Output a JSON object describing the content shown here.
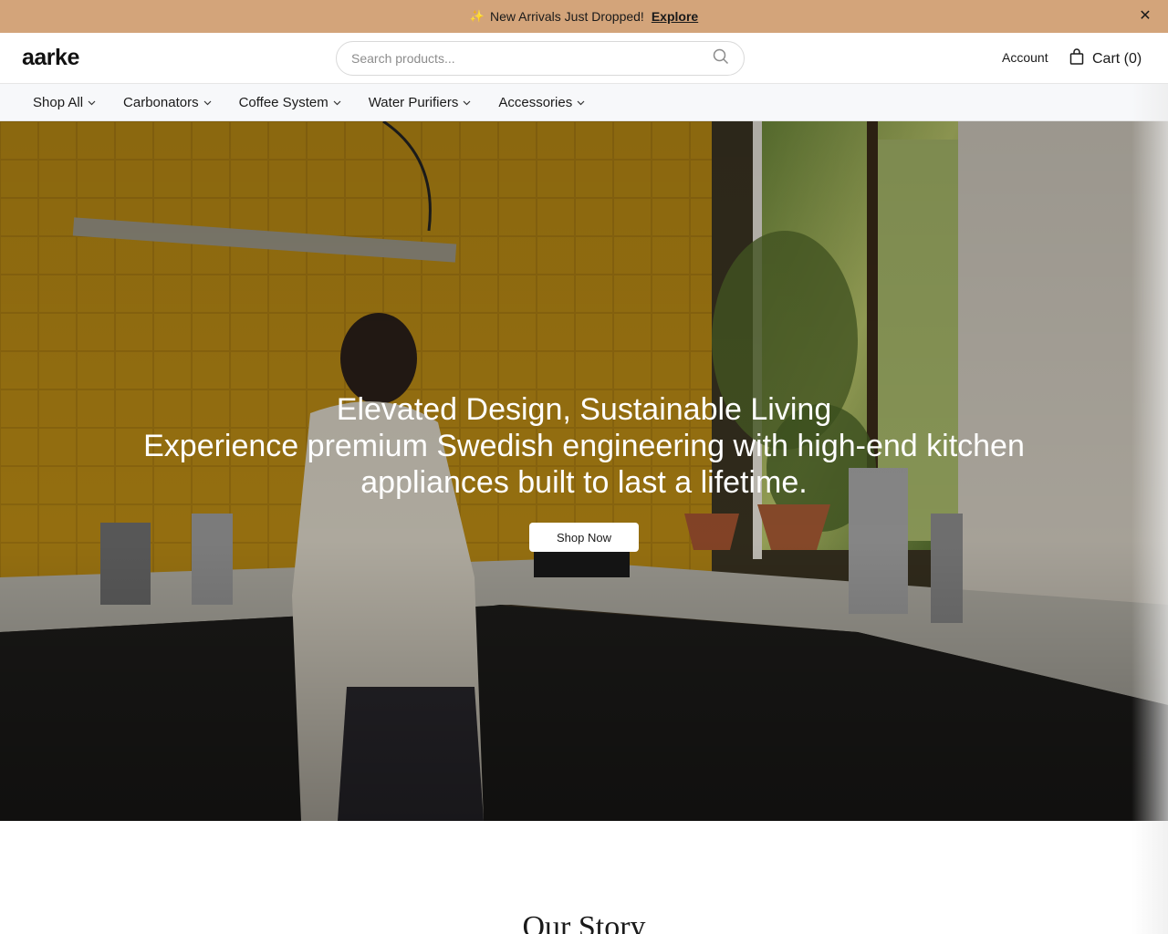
{
  "announcement": {
    "text": "New Arrivals Just Dropped!",
    "link_label": "Explore",
    "icon": "sparkle-icon",
    "close_label": "✕"
  },
  "header": {
    "logo": "aarke",
    "search_placeholder": "Search products...",
    "account_label": "Account",
    "cart_label": "Cart (0)"
  },
  "nav": {
    "items": [
      {
        "label": "Shop All"
      },
      {
        "label": "Carbonators"
      },
      {
        "label": "Coffee System"
      },
      {
        "label": "Water Purifiers"
      },
      {
        "label": "Accessories"
      }
    ]
  },
  "hero": {
    "title": "Elevated Design, Sustainable Living",
    "subtitle": "Experience premium Swedish engineering with high-end kitchen appliances built to last a lifetime.",
    "cta_label": "Shop Now"
  },
  "story": {
    "title": "Our Story"
  },
  "colors": {
    "announcement_bg": "#d3a47a",
    "nav_bg": "#f7f8fa",
    "tile_yellow": "#b98a14"
  }
}
